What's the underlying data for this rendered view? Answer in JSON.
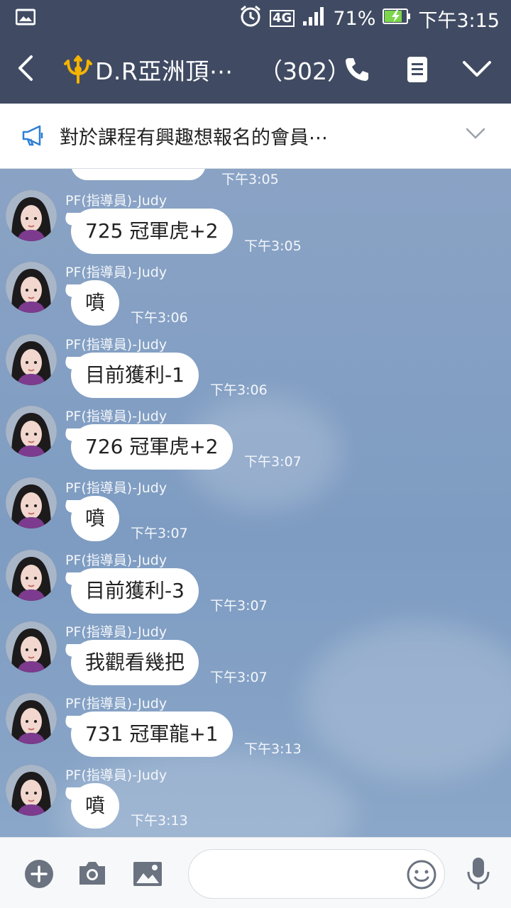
{
  "status_bar": {
    "network": "4G",
    "battery": "71%",
    "time": "下午3:15"
  },
  "header": {
    "title": "D.R亞洲頂⋯",
    "member_count": "（302）"
  },
  "announcement": {
    "text": "對於課程有興趣想報名的會員⋯"
  },
  "chat": {
    "previous_time": "下午3:05",
    "messages": [
      {
        "sender": "PF(指導員)-Judy",
        "text": "725 冠軍虎+2",
        "time": "下午3:05"
      },
      {
        "sender": "PF(指導員)-Judy",
        "text": "噴",
        "time": "下午3:06"
      },
      {
        "sender": "PF(指導員)-Judy",
        "text": "目前獲利-1",
        "time": "下午3:06"
      },
      {
        "sender": "PF(指導員)-Judy",
        "text": "726 冠軍虎+2",
        "time": "下午3:07"
      },
      {
        "sender": "PF(指導員)-Judy",
        "text": "噴",
        "time": "下午3:07"
      },
      {
        "sender": "PF(指導員)-Judy",
        "text": "目前獲利-3",
        "time": "下午3:07"
      },
      {
        "sender": "PF(指導員)-Judy",
        "text": "我觀看幾把",
        "time": "下午3:07"
      },
      {
        "sender": "PF(指導員)-Judy",
        "text": "731 冠軍龍+1",
        "time": "下午3:13"
      },
      {
        "sender": "PF(指導員)-Judy",
        "text": "噴",
        "time": "下午3:13"
      }
    ]
  },
  "input": {
    "value": "",
    "placeholder": ""
  },
  "colors": {
    "header_bg": "#404b63",
    "chat_bg": "#7f9cbf",
    "bubble_bg": "#ffffff",
    "icon_gray": "#6b7280"
  }
}
